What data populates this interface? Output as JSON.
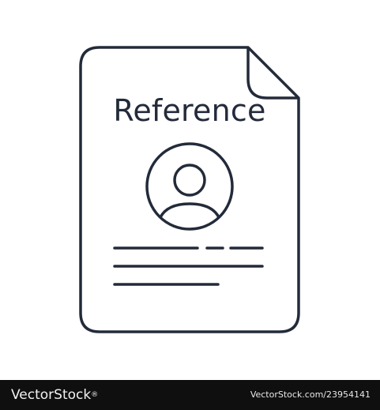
{
  "document": {
    "title": "Reference",
    "icon": "document-with-user-avatar-icon",
    "stroke_color": "#232b3a"
  },
  "footer": {
    "brand": "VectorStock",
    "registered_mark": "®",
    "stock_id": "VectorStock.com/23954141",
    "background": "#0f0f0f"
  }
}
